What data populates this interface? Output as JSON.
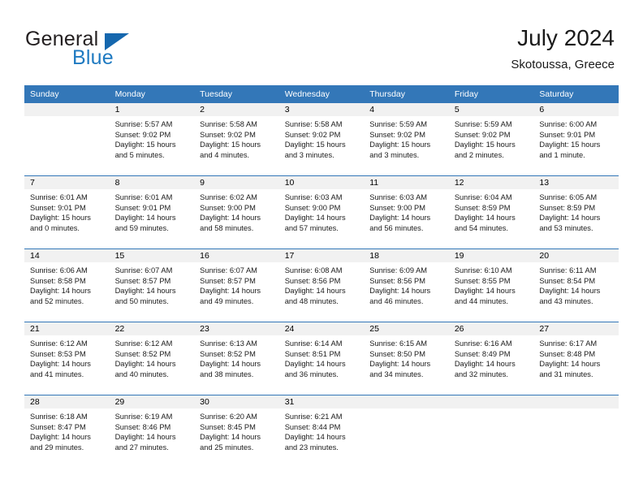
{
  "brand": {
    "name_part1": "General",
    "name_part2": "Blue",
    "triangle_color": "#1567ae",
    "blue_color": "#1f7ac1"
  },
  "header": {
    "title": "July 2024",
    "subtitle": "Skotoussa, Greece"
  },
  "calendar": {
    "header_bg": "#3377b8",
    "daynum_bg": "#f1f1f1",
    "weekday_headers": [
      "Sunday",
      "Monday",
      "Tuesday",
      "Wednesday",
      "Thursday",
      "Friday",
      "Saturday"
    ],
    "weeks": [
      [
        {
          "day": "",
          "lines": []
        },
        {
          "day": "1",
          "lines": [
            "Sunrise: 5:57 AM",
            "Sunset: 9:02 PM",
            "Daylight: 15 hours",
            "and 5 minutes."
          ]
        },
        {
          "day": "2",
          "lines": [
            "Sunrise: 5:58 AM",
            "Sunset: 9:02 PM",
            "Daylight: 15 hours",
            "and 4 minutes."
          ]
        },
        {
          "day": "3",
          "lines": [
            "Sunrise: 5:58 AM",
            "Sunset: 9:02 PM",
            "Daylight: 15 hours",
            "and 3 minutes."
          ]
        },
        {
          "day": "4",
          "lines": [
            "Sunrise: 5:59 AM",
            "Sunset: 9:02 PM",
            "Daylight: 15 hours",
            "and 3 minutes."
          ]
        },
        {
          "day": "5",
          "lines": [
            "Sunrise: 5:59 AM",
            "Sunset: 9:02 PM",
            "Daylight: 15 hours",
            "and 2 minutes."
          ]
        },
        {
          "day": "6",
          "lines": [
            "Sunrise: 6:00 AM",
            "Sunset: 9:01 PM",
            "Daylight: 15 hours",
            "and 1 minute."
          ]
        }
      ],
      [
        {
          "day": "7",
          "lines": [
            "Sunrise: 6:01 AM",
            "Sunset: 9:01 PM",
            "Daylight: 15 hours",
            "and 0 minutes."
          ]
        },
        {
          "day": "8",
          "lines": [
            "Sunrise: 6:01 AM",
            "Sunset: 9:01 PM",
            "Daylight: 14 hours",
            "and 59 minutes."
          ]
        },
        {
          "day": "9",
          "lines": [
            "Sunrise: 6:02 AM",
            "Sunset: 9:00 PM",
            "Daylight: 14 hours",
            "and 58 minutes."
          ]
        },
        {
          "day": "10",
          "lines": [
            "Sunrise: 6:03 AM",
            "Sunset: 9:00 PM",
            "Daylight: 14 hours",
            "and 57 minutes."
          ]
        },
        {
          "day": "11",
          "lines": [
            "Sunrise: 6:03 AM",
            "Sunset: 9:00 PM",
            "Daylight: 14 hours",
            "and 56 minutes."
          ]
        },
        {
          "day": "12",
          "lines": [
            "Sunrise: 6:04 AM",
            "Sunset: 8:59 PM",
            "Daylight: 14 hours",
            "and 54 minutes."
          ]
        },
        {
          "day": "13",
          "lines": [
            "Sunrise: 6:05 AM",
            "Sunset: 8:59 PM",
            "Daylight: 14 hours",
            "and 53 minutes."
          ]
        }
      ],
      [
        {
          "day": "14",
          "lines": [
            "Sunrise: 6:06 AM",
            "Sunset: 8:58 PM",
            "Daylight: 14 hours",
            "and 52 minutes."
          ]
        },
        {
          "day": "15",
          "lines": [
            "Sunrise: 6:07 AM",
            "Sunset: 8:57 PM",
            "Daylight: 14 hours",
            "and 50 minutes."
          ]
        },
        {
          "day": "16",
          "lines": [
            "Sunrise: 6:07 AM",
            "Sunset: 8:57 PM",
            "Daylight: 14 hours",
            "and 49 minutes."
          ]
        },
        {
          "day": "17",
          "lines": [
            "Sunrise: 6:08 AM",
            "Sunset: 8:56 PM",
            "Daylight: 14 hours",
            "and 48 minutes."
          ]
        },
        {
          "day": "18",
          "lines": [
            "Sunrise: 6:09 AM",
            "Sunset: 8:56 PM",
            "Daylight: 14 hours",
            "and 46 minutes."
          ]
        },
        {
          "day": "19",
          "lines": [
            "Sunrise: 6:10 AM",
            "Sunset: 8:55 PM",
            "Daylight: 14 hours",
            "and 44 minutes."
          ]
        },
        {
          "day": "20",
          "lines": [
            "Sunrise: 6:11 AM",
            "Sunset: 8:54 PM",
            "Daylight: 14 hours",
            "and 43 minutes."
          ]
        }
      ],
      [
        {
          "day": "21",
          "lines": [
            "Sunrise: 6:12 AM",
            "Sunset: 8:53 PM",
            "Daylight: 14 hours",
            "and 41 minutes."
          ]
        },
        {
          "day": "22",
          "lines": [
            "Sunrise: 6:12 AM",
            "Sunset: 8:52 PM",
            "Daylight: 14 hours",
            "and 40 minutes."
          ]
        },
        {
          "day": "23",
          "lines": [
            "Sunrise: 6:13 AM",
            "Sunset: 8:52 PM",
            "Daylight: 14 hours",
            "and 38 minutes."
          ]
        },
        {
          "day": "24",
          "lines": [
            "Sunrise: 6:14 AM",
            "Sunset: 8:51 PM",
            "Daylight: 14 hours",
            "and 36 minutes."
          ]
        },
        {
          "day": "25",
          "lines": [
            "Sunrise: 6:15 AM",
            "Sunset: 8:50 PM",
            "Daylight: 14 hours",
            "and 34 minutes."
          ]
        },
        {
          "day": "26",
          "lines": [
            "Sunrise: 6:16 AM",
            "Sunset: 8:49 PM",
            "Daylight: 14 hours",
            "and 32 minutes."
          ]
        },
        {
          "day": "27",
          "lines": [
            "Sunrise: 6:17 AM",
            "Sunset: 8:48 PM",
            "Daylight: 14 hours",
            "and 31 minutes."
          ]
        }
      ],
      [
        {
          "day": "28",
          "lines": [
            "Sunrise: 6:18 AM",
            "Sunset: 8:47 PM",
            "Daylight: 14 hours",
            "and 29 minutes."
          ]
        },
        {
          "day": "29",
          "lines": [
            "Sunrise: 6:19 AM",
            "Sunset: 8:46 PM",
            "Daylight: 14 hours",
            "and 27 minutes."
          ]
        },
        {
          "day": "30",
          "lines": [
            "Sunrise: 6:20 AM",
            "Sunset: 8:45 PM",
            "Daylight: 14 hours",
            "and 25 minutes."
          ]
        },
        {
          "day": "31",
          "lines": [
            "Sunrise: 6:21 AM",
            "Sunset: 8:44 PM",
            "Daylight: 14 hours",
            "and 23 minutes."
          ]
        },
        {
          "day": "",
          "lines": []
        },
        {
          "day": "",
          "lines": []
        },
        {
          "day": "",
          "lines": []
        }
      ]
    ]
  }
}
